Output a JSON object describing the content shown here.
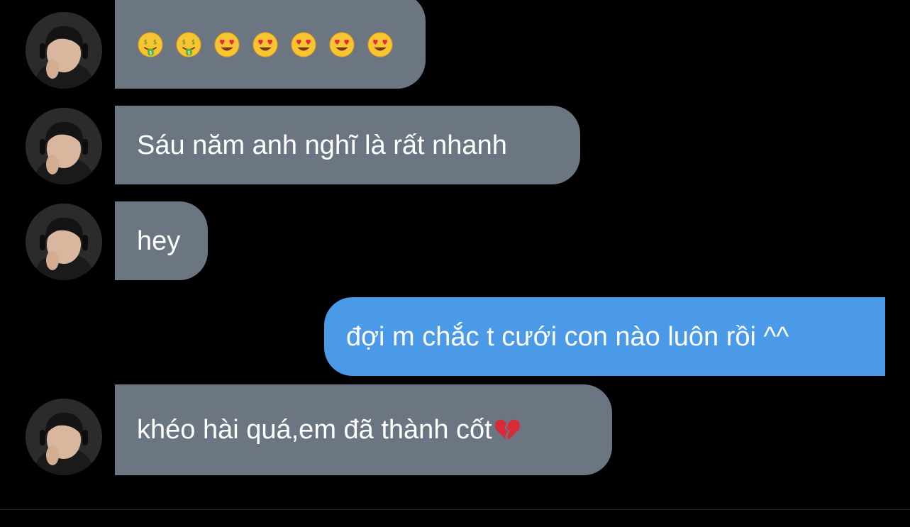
{
  "messages": [
    {
      "sender": "them",
      "emojis": [
        "money-mouth-face",
        "money-mouth-face",
        "heart-eyes-face",
        "heart-eyes-face",
        "heart-eyes-face",
        "heart-eyes-face",
        "heart-eyes-face"
      ]
    },
    {
      "sender": "them",
      "text": "Sáu năm anh nghĩ là rất nhanh"
    },
    {
      "sender": "them",
      "text": "hey"
    },
    {
      "sender": "me",
      "text": "đợi m chắc t cưới con nào luôn rồi ^^"
    },
    {
      "sender": "them",
      "text": "khéo hài quá,em đã thành cốt",
      "trailing_emoji": "broken-heart"
    }
  ],
  "colors": {
    "background": "#000000",
    "received_bubble": "#6b7682",
    "sent_bubble": "#4a9ae7",
    "text": "#ffffff"
  }
}
